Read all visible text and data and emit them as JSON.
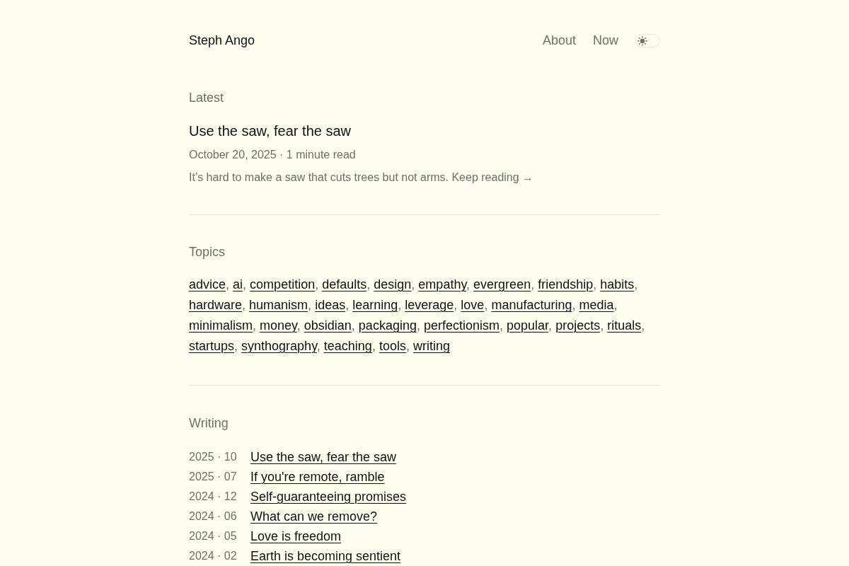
{
  "header": {
    "site_title": "Steph Ango",
    "nav": [
      {
        "label": "About"
      },
      {
        "label": "Now"
      }
    ],
    "theme_toggle": {
      "on": false
    }
  },
  "latest": {
    "heading": "Latest",
    "title": "Use the saw, fear the saw",
    "meta": "October 20, 2025 · 1 minute read",
    "excerpt": "It’s hard to make a saw that cuts trees but not arms.",
    "link": "Keep reading →"
  },
  "topics": {
    "heading": "Topics",
    "separator": ",",
    "items": [
      "advice",
      "ai",
      "competition",
      "defaults",
      "design",
      "empathy",
      "evergreen",
      "friendship",
      "habits",
      "hardware",
      "humanism",
      "ideas",
      "learning",
      "leverage",
      "love",
      "manufacturing",
      "media",
      "minimalism",
      "money",
      "obsidian",
      "packaging",
      "perfectionism",
      "popular",
      "projects",
      "rituals",
      "startups",
      "synthography",
      "teaching",
      "tools",
      "writing"
    ]
  },
  "writing": {
    "heading": "Writing",
    "rows": [
      {
        "date": "2025 · 10",
        "title": "Use the saw, fear the saw"
      },
      {
        "date": "2025 · 07",
        "title": "If you're remote, ramble"
      },
      {
        "date": "2024 · 12",
        "title": "Self-guaranteeing promises"
      },
      {
        "date": "2024 · 06",
        "title": "What can we remove?"
      },
      {
        "date": "2024 · 05",
        "title": "Love is freedom"
      },
      {
        "date": "2024 · 02",
        "title": "Earth is becoming sentient"
      }
    ]
  }
}
